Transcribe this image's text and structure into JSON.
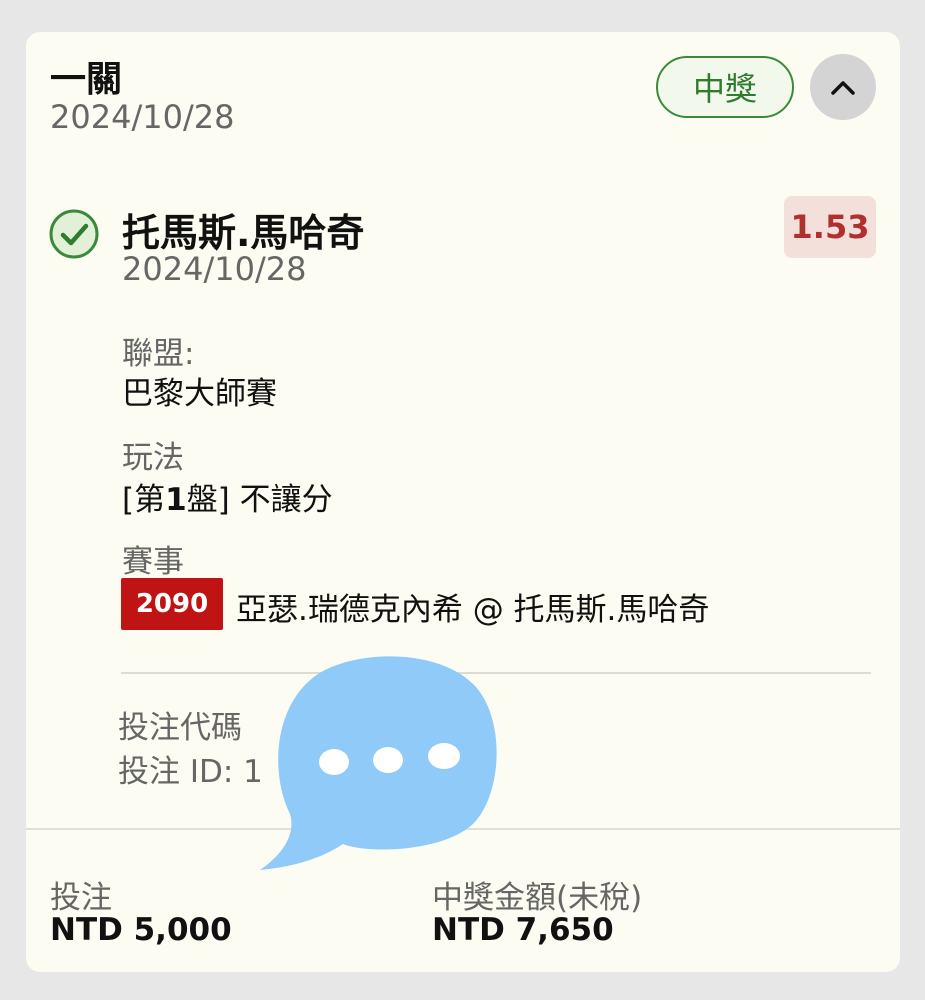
{
  "ticket": {
    "bet_type": "一關",
    "date": "2024/10/28",
    "status": "中獎",
    "collapse_icon": "chevron-up-icon"
  },
  "selection": {
    "status_icon": "check-circle-icon",
    "name": "托馬斯.馬哈奇",
    "date": "2024/10/28",
    "odds": "1.53",
    "league_label": "聯盟:",
    "league_value": "巴黎大師賽",
    "market_label": "玩法",
    "market_prefix": "[第",
    "market_number": "1",
    "market_suffix": "盤] 不讓分",
    "event_label": "賽事",
    "match_code": "2090",
    "event_value": "亞瑟.瑞德克內希 @ 托馬斯.馬哈奇"
  },
  "codes": {
    "bet_code_label": "投注代碼",
    "bet_id_label": "投注 ID:",
    "bet_id_partial": "1"
  },
  "footer": {
    "stake_label": "投注",
    "stake_value": "NTD 5,000",
    "payout_label": "中獎金額(未稅)",
    "payout_value": "NTD 7,650"
  },
  "overlay": {
    "icon": "chat-bubble-icon"
  },
  "colors": {
    "page_background": "#e7e7e7",
    "card_background": "#fcfcf3",
    "win_green": "#2f7c2f",
    "odds_red": "#b03030",
    "tag_red": "#c01414",
    "overlay_blue": "#90caf9"
  }
}
